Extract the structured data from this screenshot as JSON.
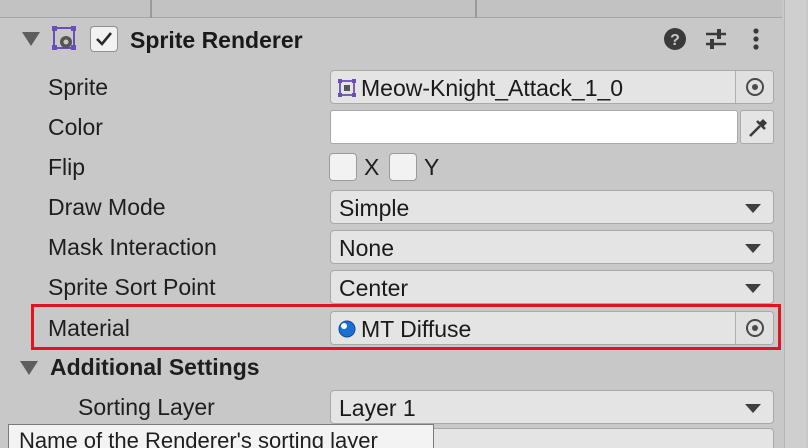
{
  "component": {
    "title": "Sprite Renderer",
    "enabled": true,
    "icon": "sprite-renderer-icon",
    "buttons": [
      "help-icon",
      "preset-icon",
      "kebab-menu-icon"
    ]
  },
  "rows": {
    "sprite": {
      "label": "Sprite",
      "value": "Meow-Knight_Attack_1_0",
      "icon": "sprite-icon"
    },
    "color": {
      "label": "Color",
      "value": "#ffffff"
    },
    "flip": {
      "label": "Flip",
      "x_label": "X",
      "y_label": "Y",
      "x_checked": false,
      "y_checked": false
    },
    "draw_mode": {
      "label": "Draw Mode",
      "value": "Simple"
    },
    "mask_interaction": {
      "label": "Mask Interaction",
      "value": "None"
    },
    "sort_point": {
      "label": "Sprite Sort Point",
      "value": "Center"
    },
    "material": {
      "label": "Material",
      "value": "MT Diffuse",
      "icon": "material-icon"
    }
  },
  "additional": {
    "title": "Additional Settings",
    "sorting_layer": {
      "label": "Sorting Layer",
      "value": "Layer 1"
    }
  },
  "tooltip": "Name of the Renderer's sorting layer",
  "colors": {
    "highlight": "#e0141b",
    "accent": "#1a6fd1",
    "icon_purple": "#6b4fb8"
  }
}
